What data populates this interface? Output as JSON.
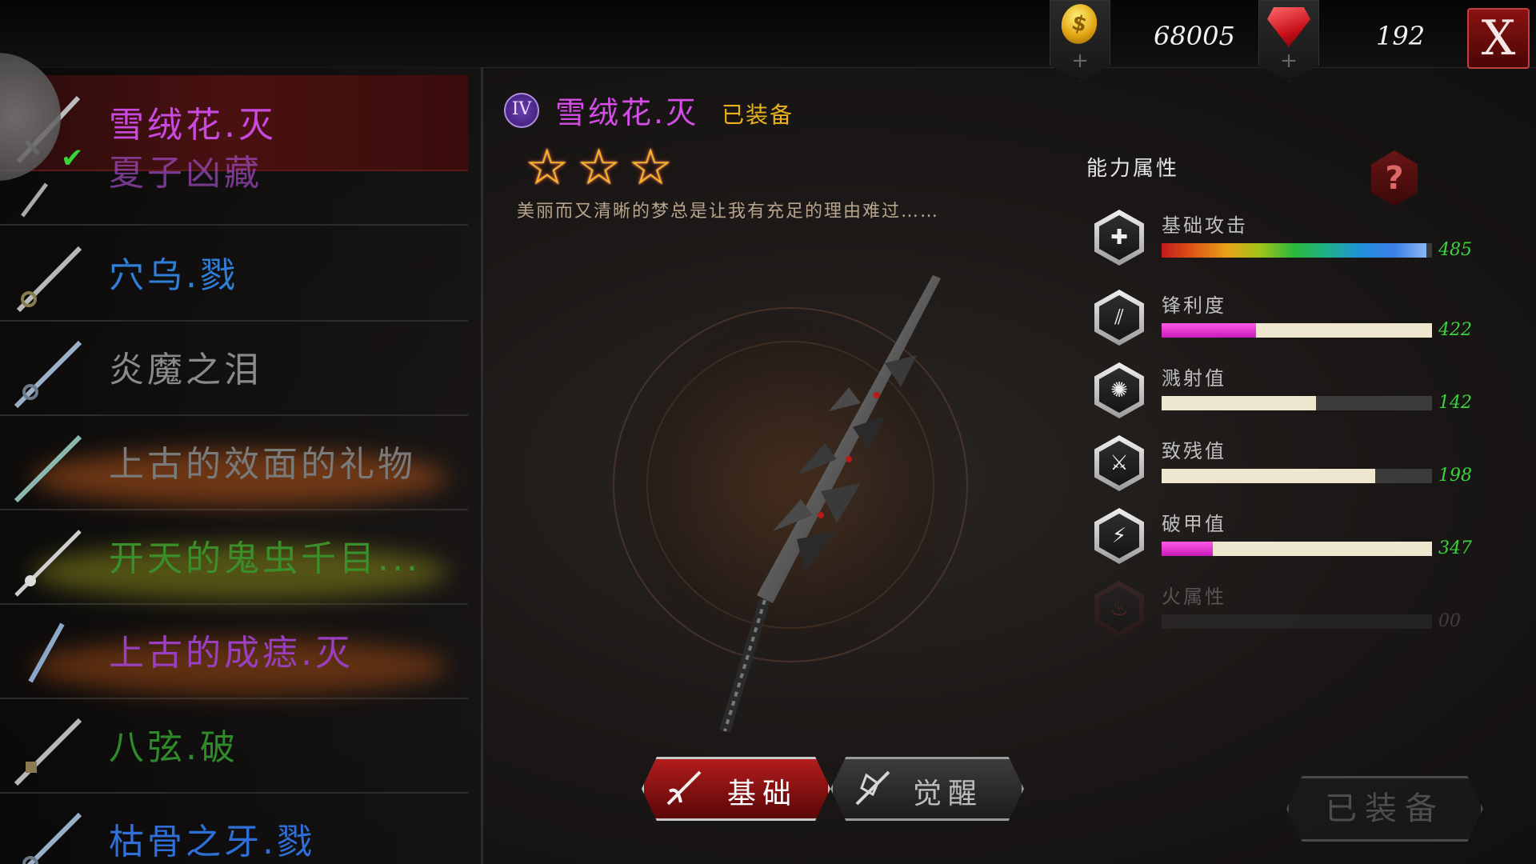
{
  "currency": {
    "gold_icon": "gold-coin-icon",
    "gold_value": "68005",
    "gem_icon": "red-gem-icon",
    "gem_value": "192",
    "plus": "+"
  },
  "close_label": "X",
  "weapon_list": [
    {
      "name": "雪绒花.灭",
      "color": "#c94ae0",
      "selected": true,
      "equipped": true
    },
    {
      "name": "夏子凶藏",
      "color": "#a24cc4"
    },
    {
      "name": "穴乌.戮",
      "color": "#2f7fd8"
    },
    {
      "name": "炎魔之泪",
      "color": "#8a8a8a"
    },
    {
      "name": "上古的效面的礼物",
      "color": "#7a7a7a"
    },
    {
      "name": "开天的鬼虫千目...",
      "color": "#3b8f2a"
    },
    {
      "name": "上古的成痣.灭",
      "color": "#9a3fc0"
    },
    {
      "name": "八弦.破",
      "color": "#2e8a2a"
    },
    {
      "name": "枯骨之牙.戮",
      "color": "#2f6fd8"
    }
  ],
  "check_mark": "✔",
  "detail": {
    "tier": "IV",
    "title": "雪绒花.灭",
    "equipped_tag": "已装备",
    "stars": [
      "☆",
      "☆",
      "☆"
    ],
    "flavor": "美丽而又清晰的梦总是让我有充足的理由难过……"
  },
  "tabs": {
    "basic": "基础",
    "awaken": "觉醒"
  },
  "attributes": {
    "title": "能力属性",
    "help": "?",
    "stats": [
      {
        "label": "基础攻击",
        "value": "485",
        "icon": "attack-icon",
        "style": "rainbow",
        "fill": 0.98
      },
      {
        "label": "锋利度",
        "value": "422",
        "icon": "sharpness-icon",
        "style": "pink-cream",
        "hi": 0.35,
        "fill": 1.0
      },
      {
        "label": "溅射值",
        "value": "142",
        "icon": "splash-icon",
        "style": "cream",
        "fill": 0.57
      },
      {
        "label": "致残值",
        "value": "198",
        "icon": "cripple-icon",
        "style": "cream",
        "fill": 0.79
      },
      {
        "label": "破甲值",
        "value": "347",
        "icon": "armor-break-icon",
        "style": "pink-cream",
        "hi": 0.19,
        "fill": 1.0
      },
      {
        "label": "火属性",
        "value": "00",
        "icon": "fire-icon",
        "style": "empty",
        "fill": 0,
        "disabled": true
      }
    ]
  },
  "equip_button": "已装备"
}
